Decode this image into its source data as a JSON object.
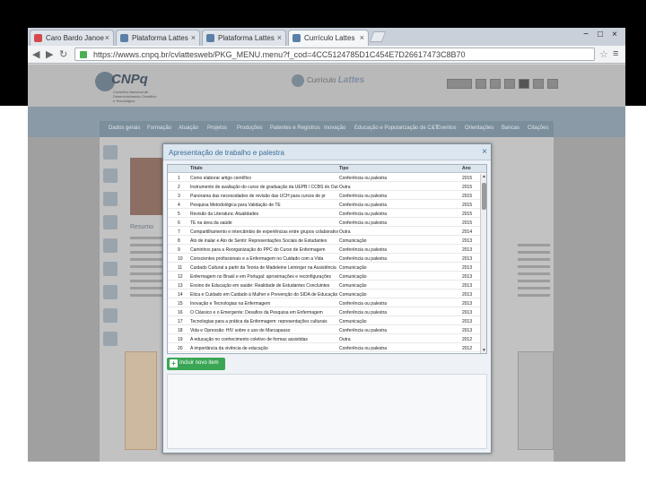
{
  "browser": {
    "tabs": [
      {
        "label": "Caro Bardo Janoe",
        "favicon_color": "#d34a4a"
      },
      {
        "label": "Plataforma Lattes",
        "favicon_color": "#5a7fa8"
      },
      {
        "label": "Plataforma Lattes",
        "favicon_color": "#5a7fa8"
      },
      {
        "label": "Currículo Lattes",
        "favicon_color": "#5a7fa8"
      }
    ],
    "tab_close_glyph": "×",
    "url": "https://wwws.cnpq.br/cvlattesweb/PKG_MENU.menu?f_cod=4CC5124785D1C454E7D26617473C8B70",
    "window_controls": [
      "−",
      "□",
      "×"
    ]
  },
  "header": {
    "cnpq_logo_text": "CNPq",
    "cnpq_subtitle": "Conselho Nacional de Desenvolvimento Científico e Tecnológico",
    "platform_text": "Currículo",
    "platform_brand": "Lattes"
  },
  "menu": {
    "items": [
      "Dados gerais",
      "Formação",
      "Atuação",
      "Projetos",
      "Produções",
      "Patentes e Registros",
      "Inovação",
      "Educação e Popularização de C&T",
      "Eventos",
      "Orientações",
      "Bancas",
      "Citações"
    ]
  },
  "sidebar": {
    "resumo_label": "Resumo"
  },
  "modal": {
    "title": "Apresentação de trabalho e palestra",
    "close_glyph": "×",
    "columns": {
      "num": "",
      "title": "Título",
      "type": "Tipo",
      "year": "Ano"
    },
    "rows": [
      {
        "n": "1",
        "title": "Como elaborar artigo científico",
        "type": "Conferência ou palestra",
        "year": "2015"
      },
      {
        "n": "2",
        "title": "Instrumento de avaliação do curso de graduação da UEPB / CCBS do Outro",
        "type": "Outra",
        "year": "2015"
      },
      {
        "n": "3",
        "title": "Panorama das necessidades de revisão das UCH para cursos de pr",
        "type": "Conferência ou palestra",
        "year": "2015"
      },
      {
        "n": "4",
        "title": "Pesquisa Metodológica para Validação de TE",
        "type": "Conferência ou palestra",
        "year": "2015"
      },
      {
        "n": "5",
        "title": "Revisão da Literatura: Atualidades",
        "type": "Conferência ou palestra",
        "year": "2015"
      },
      {
        "n": "6",
        "title": "TE na área da saúde",
        "type": "Conferência ou palestra",
        "year": "2015"
      },
      {
        "n": "7",
        "title": "Compartilhamento e intercâmbio de experiências entre grupos colaborativos",
        "type": "Outra",
        "year": "2014"
      },
      {
        "n": "8",
        "title": "Ato de inalar e Ato de Sentir: Representações Sociais de Estudantes",
        "type": "Comunicação",
        "year": "2013"
      },
      {
        "n": "9",
        "title": "Caminhos para a Reorganização do PPC do Curso de Enfermagem",
        "type": "Conferência ou palestra",
        "year": "2013"
      },
      {
        "n": "10",
        "title": "Conscientes profissionais e a Enfermagem no Cuidado com a Vida",
        "type": "Conferência ou palestra",
        "year": "2013"
      },
      {
        "n": "11",
        "title": "Cuidado Cultural a partir da Teoria de Madeleine Leininger na Assistência",
        "type": "Comunicação",
        "year": "2013"
      },
      {
        "n": "12",
        "title": "Enfermagem no Brasil e em Portugal: aproximações e reconfigurações",
        "type": "Comunicação",
        "year": "2013"
      },
      {
        "n": "13",
        "title": "Ensino de Educação em saúde: Realidade de Estudantes Concluintes",
        "type": "Comunicação",
        "year": "2013"
      },
      {
        "n": "14",
        "title": "Ética e Cuidado em Cuidado à Mulher e Prevenção do SIDA de Educação",
        "type": "Comunicação",
        "year": "2013"
      },
      {
        "n": "15",
        "title": "Inovação e Tecnologias na Enfermagem",
        "type": "Conferência ou palestra",
        "year": "2013"
      },
      {
        "n": "16",
        "title": "O Clássico e o Emergente: Desafios da Pesquisa em Enfermagem",
        "type": "Conferência ou palestra",
        "year": "2013"
      },
      {
        "n": "17",
        "title": "Tecnologias para a prática da Enfermagem: representações culturais",
        "type": "Comunicação",
        "year": "2013"
      },
      {
        "n": "18",
        "title": "Vida e Opressão: HIV sobre o uso de Marcapasso",
        "type": "Conferência ou palestra",
        "year": "2013"
      },
      {
        "n": "19",
        "title": "A educação no conhecimento coletivo de formas assistidas",
        "type": "Outra",
        "year": "2012"
      },
      {
        "n": "20",
        "title": "A importância da vivência de educação",
        "type": "Conferência ou palestra",
        "year": "2012"
      }
    ],
    "scroll_up": "▲",
    "scroll_down": "▼",
    "add_button_label": "Incluir novo item",
    "add_button_icon": "plus-icon"
  }
}
